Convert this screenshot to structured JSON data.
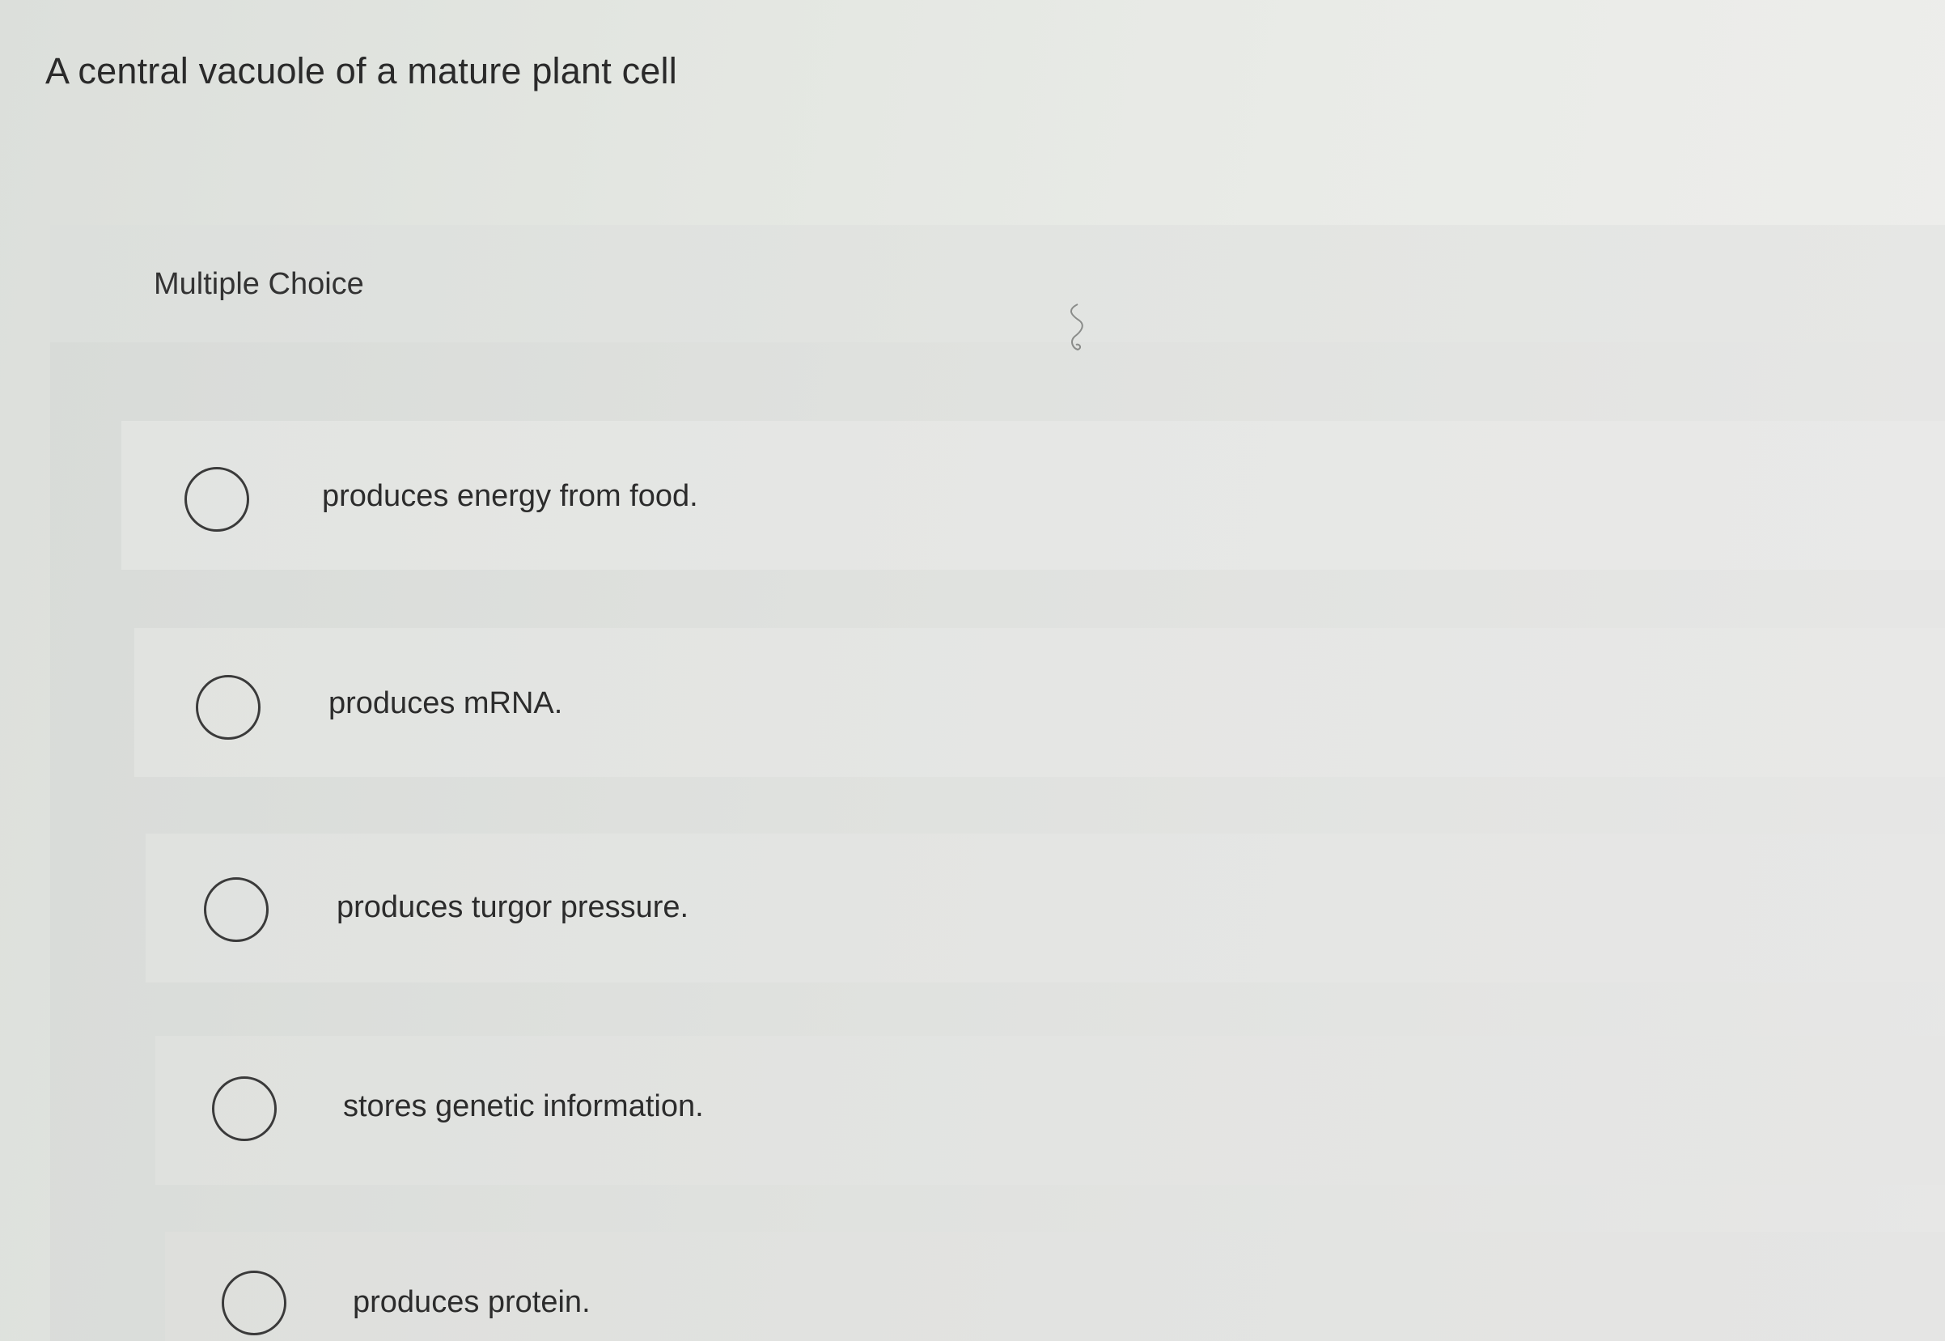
{
  "question": {
    "text": "A central vacuole of a mature plant cell"
  },
  "panel": {
    "type_label": "Multiple Choice"
  },
  "choices": [
    {
      "text": "produces energy from food.",
      "selected": false
    },
    {
      "text": "produces mRNA.",
      "selected": false
    },
    {
      "text": "produces turgor pressure.",
      "selected": false
    },
    {
      "text": "stores genetic information.",
      "selected": false
    },
    {
      "text": "produces protein.",
      "selected": false
    }
  ],
  "icons": {
    "radio": "radio-unchecked-icon"
  }
}
